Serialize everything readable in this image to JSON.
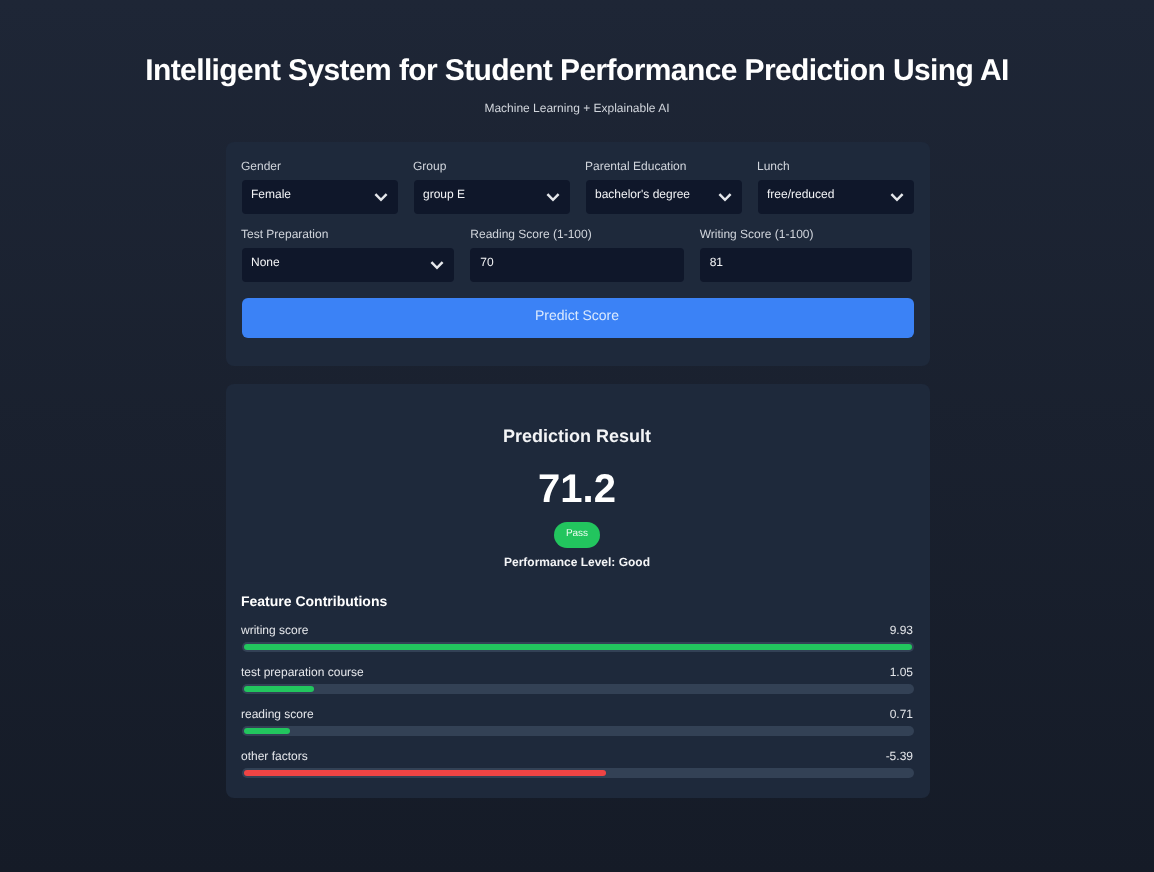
{
  "title": "Intelligent System for Student Performance Prediction Using AI",
  "subtitle": "Machine Learning + Explainable AI",
  "form": {
    "fields": [
      {
        "kind": "select",
        "label": "Gender",
        "value": "Female"
      },
      {
        "kind": "select",
        "label": "Group",
        "value": "group E"
      },
      {
        "kind": "select",
        "label": "Parental Education",
        "value": "bachelor's degree"
      },
      {
        "kind": "select",
        "label": "Lunch",
        "value": "free/reduced"
      },
      {
        "kind": "select",
        "label": "Test Preparation",
        "value": "None"
      },
      {
        "kind": "input",
        "label": "Reading Score (1-100)",
        "value": "70"
      },
      {
        "kind": "input",
        "label": "Writing Score (1-100)",
        "value": "81"
      }
    ],
    "button": "Predict Score"
  },
  "result": {
    "title": "Prediction Result",
    "score": "71.2",
    "badge": "Pass",
    "level_text": "Performance Level: Good",
    "contributions_title": "Feature Contributions",
    "contributions": [
      {
        "name": "writing score",
        "value": "9.93",
        "level": 1.0,
        "kind": "positive"
      },
      {
        "name": "test preparation course",
        "value": "1.05",
        "level": 0.105,
        "kind": "positive"
      },
      {
        "name": "reading score",
        "value": "0.71",
        "level": 0.071,
        "kind": "positive"
      },
      {
        "name": "other factors",
        "value": "-5.39",
        "level": 0.543,
        "kind": "negative"
      }
    ]
  }
}
